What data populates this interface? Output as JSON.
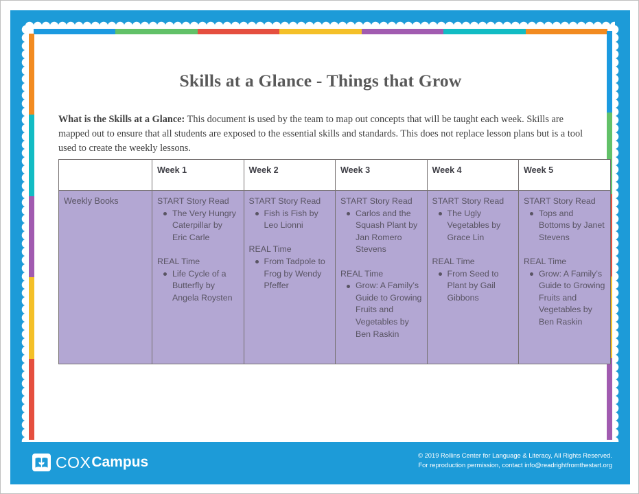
{
  "document": {
    "title": "Skills at a Glance - Things that Grow",
    "intro_label": "What is the Skills at a Glance:",
    "intro_body": "  This document is used by the team to map out concepts that will be taught each week.  Skills are mapped out to ensure that all students are exposed to the essential skills and standards.  This does not replace lesson plans but is a tool used to create the weekly lessons."
  },
  "table": {
    "corner_header": "",
    "headers": [
      "Week 1",
      "Week 2",
      "Week 3",
      "Week 4",
      "Week 5"
    ],
    "row_label": "Weekly Books",
    "section_labels": {
      "start": "START Story Read",
      "real": "REAL Time"
    },
    "cells": [
      {
        "week": "Week 1",
        "start_head": "START Story Read",
        "start_items": [
          "The Very Hungry Caterpillar by Eric Carle"
        ],
        "real_head": "REAL Time",
        "real_items": [
          "Life Cycle of a Butterfly by Angela Roysten"
        ]
      },
      {
        "week": "Week 2",
        "start_head": "START Story Read",
        "start_items": [
          "Fish is Fish by Leo Lionni"
        ],
        "real_head": "REAL Time",
        "real_items": [
          "From Tadpole to Frog by Wendy Pfeffer"
        ]
      },
      {
        "week": "Week 3",
        "start_head": "START Story Read",
        "start_items": [
          "Carlos and the Squash Plant by Jan Romero Stevens"
        ],
        "real_head": "REAL Time",
        "real_items": [
          "Grow: A Family’s Guide to Growing Fruits and Vegetables by Ben Raskin"
        ]
      },
      {
        "week": "Week 4",
        "start_head": "START Story Read",
        "start_items": [
          "The Ugly Vegetables by Grace Lin"
        ],
        "real_head": "REAL Time",
        "real_items": [
          "From Seed to Plant by Gail Gibbons"
        ]
      },
      {
        "week": "Week 5",
        "start_head": "START Story Read",
        "start_items": [
          "Tops and Bottoms by Janet Stevens"
        ],
        "real_head": "REAL Time",
        "real_items": [
          "Grow: A Family’s Guide to Growing Fruits and Vegetables by Ben Raskin"
        ]
      }
    ]
  },
  "footer": {
    "logo_primary": "COX",
    "logo_secondary": "Campus",
    "copyright_line1": "© 2019 Rollins Center for Language & Literacy, All Rights Reserved.",
    "copyright_line2": "For reproduction permission, contact info@readrightfromthestart.org"
  },
  "colors": {
    "frame_blue": "#1d9bd8",
    "cell_purple": "#b3a7d3",
    "text_gray": "#595463",
    "title_gray": "#595959",
    "stripe_blue": "#1b9ae0",
    "stripe_green": "#62c168",
    "stripe_red": "#e54f3f",
    "stripe_yellow": "#f4c028",
    "stripe_purple": "#a15bb0",
    "stripe_teal": "#12bcc4",
    "stripe_orange": "#f28b21"
  },
  "stripes": {
    "top": [
      "#1b9ae0",
      "#62c168",
      "#e54f3f",
      "#f4c028",
      "#a15bb0",
      "#12bcc4",
      "#f28b21"
    ],
    "left": [
      "#f28b21",
      "#12bcc4",
      "#a15bb0",
      "#f4c028",
      "#e54f3f"
    ],
    "right": [
      "#1b9ae0",
      "#62c168",
      "#e54f3f",
      "#f4c028",
      "#a15bb0"
    ]
  }
}
